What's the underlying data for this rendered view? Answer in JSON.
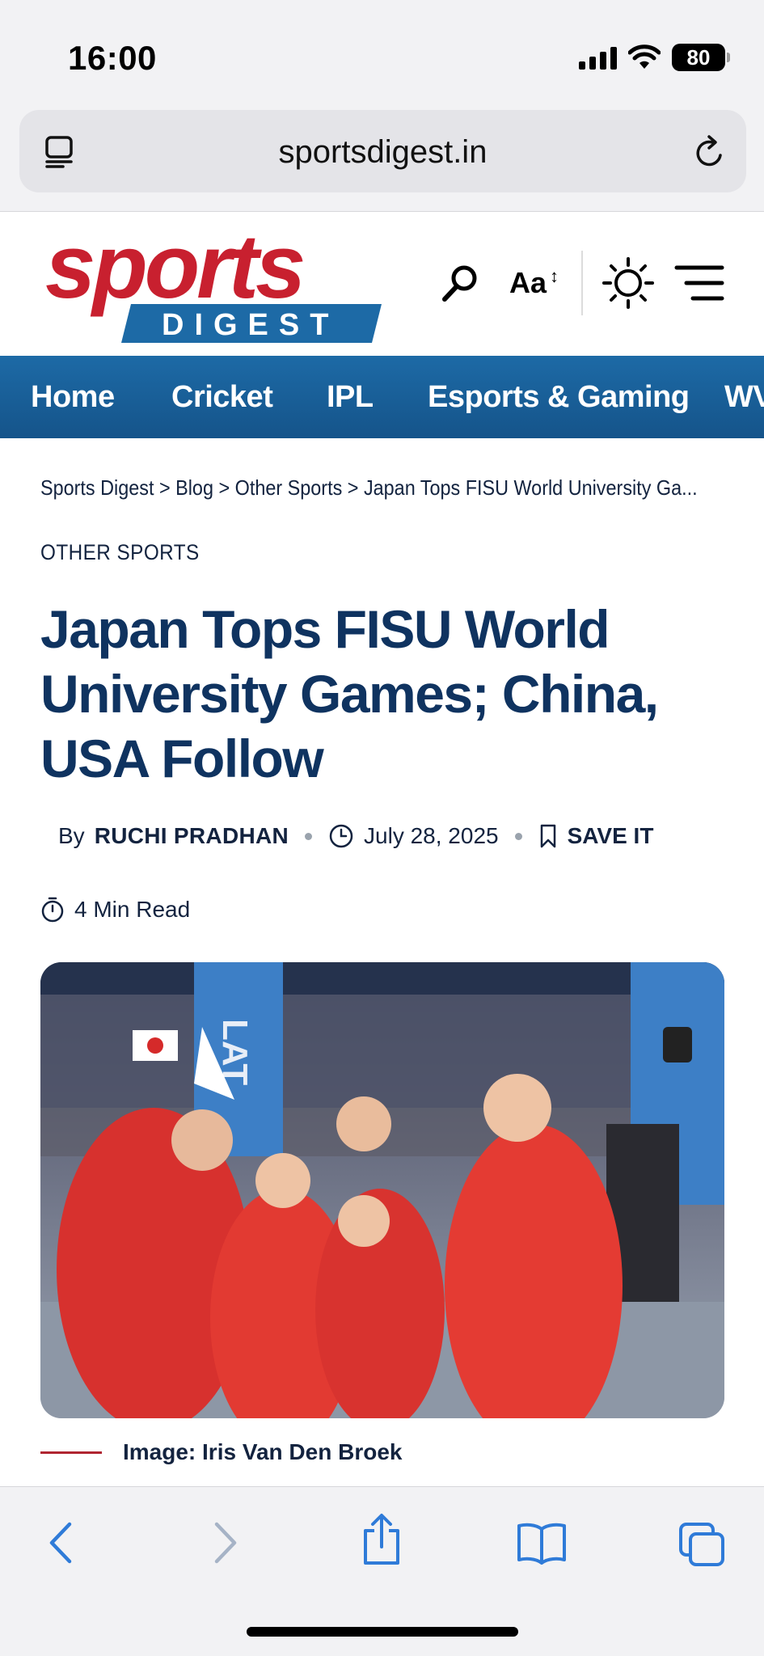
{
  "status": {
    "time": "16:00",
    "battery": "80"
  },
  "browser": {
    "url": "sportsdigest.in"
  },
  "site": {
    "logo_top": "sports",
    "logo_bottom": "DIGEST",
    "font_size_label": "Aa",
    "font_size_arrow": "↕"
  },
  "nav": {
    "items": [
      "Home",
      "Cricket",
      "IPL",
      "Esports & Gaming",
      "WV"
    ]
  },
  "article": {
    "breadcrumb": "Sports Digest > Blog > Other Sports > Japan Tops FISU World University Ga...",
    "category": "OTHER SPORTS",
    "title": "Japan Tops FISU World University Games; China, USA Follow",
    "by": "By",
    "author": "RUCHI PRADHAN",
    "date": "July 28, 2025",
    "save_label": "SAVE IT",
    "read_time": "4 Min Read",
    "hero_banner": "LAT",
    "caption": "Image: Iris Van Den Broek"
  },
  "colors": {
    "nav_blue": "#1d6aa6",
    "title_navy": "#0f3360",
    "logo_red": "#c8202f",
    "safari_blue": "#2f7bd8"
  }
}
